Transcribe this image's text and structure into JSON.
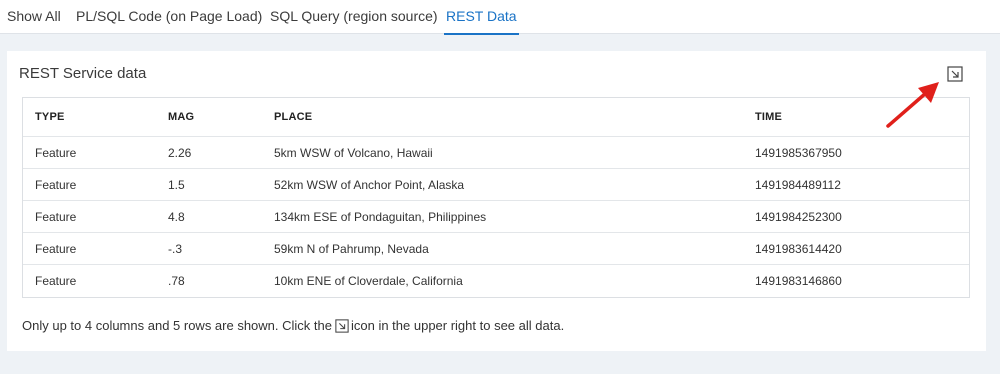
{
  "tabs": [
    {
      "label": "Show All",
      "active": false
    },
    {
      "label": "PL/SQL Code (on Page Load)",
      "active": false
    },
    {
      "label": "SQL Query (region source)",
      "active": false
    },
    {
      "label": "REST Data",
      "active": true
    }
  ],
  "region": {
    "title": "REST Service data",
    "expand_icon": "expand-arrow-icon"
  },
  "table": {
    "columns": [
      "TYPE",
      "MAG",
      "PLACE",
      "TIME"
    ],
    "rows": [
      [
        "Feature",
        "2.26",
        "5km WSW of Volcano, Hawaii",
        "1491985367950"
      ],
      [
        "Feature",
        "1.5",
        "52km WSW of Anchor Point, Alaska",
        "1491984489112"
      ],
      [
        "Feature",
        "4.8",
        "134km ESE of Pondaguitan, Philippines",
        "1491984252300"
      ],
      [
        "Feature",
        "-.3",
        "59km N of Pahrump, Nevada",
        "1491983614420"
      ],
      [
        "Feature",
        ".78",
        "10km ENE of Cloverdale, California",
        "1491983146860"
      ]
    ]
  },
  "footnote": {
    "before": "Only up to 4 columns and 5 rows are shown. Click the",
    "after": "icon in the upper right to see all data."
  },
  "colors": {
    "accent": "#1a73c6",
    "annotation": "#e0201b",
    "background": "#eef2f6"
  }
}
